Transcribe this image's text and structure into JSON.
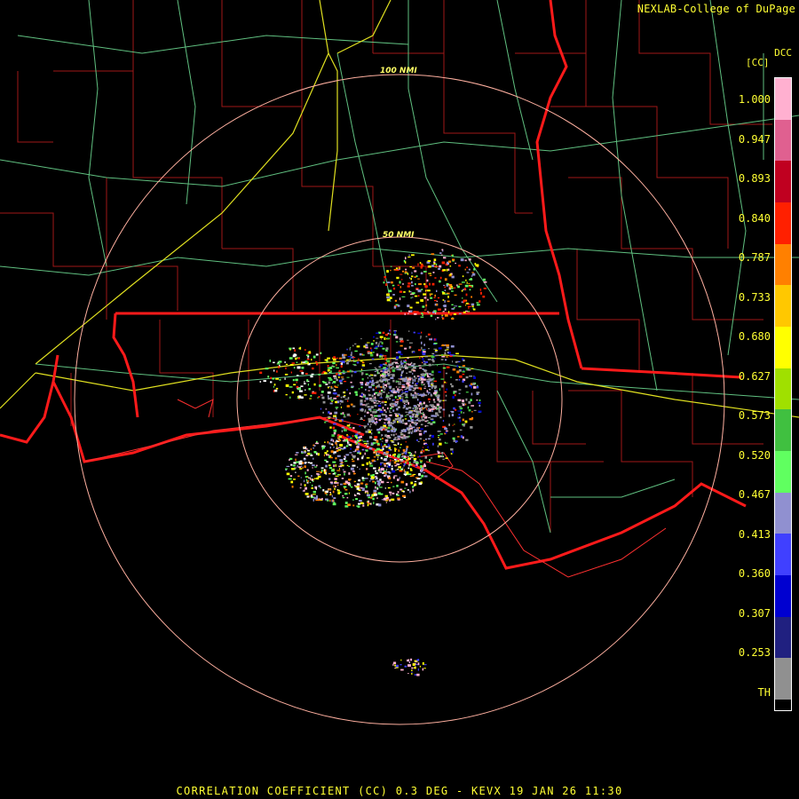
{
  "credit": "NEXLAB-College of DuPage",
  "product_code": "DCC",
  "unit": "[CC]",
  "ring_labels": [
    "100 NMI",
    "50 NMI"
  ],
  "legend": {
    "ticks": [
      "1.000",
      "0.947",
      "0.893",
      "0.840",
      "0.787",
      "0.733",
      "0.680",
      "0.627",
      "0.573",
      "0.520",
      "0.467",
      "0.413",
      "0.360",
      "0.307",
      "0.253",
      "TH"
    ],
    "colors": [
      "#ffb0d0",
      "#e06090",
      "#c00020",
      "#ff2000",
      "#ff8000",
      "#ffc800",
      "#ffff00",
      "#a0e000",
      "#40c040",
      "#60ff60",
      "#9090d0",
      "#4040ff",
      "#0000d0",
      "#202080",
      "#909090",
      "#000000"
    ]
  },
  "caption": "CORRELATION COEFFICIENT (CC) 0.3 DEG - KEVX 19 JAN 26 11:30"
}
